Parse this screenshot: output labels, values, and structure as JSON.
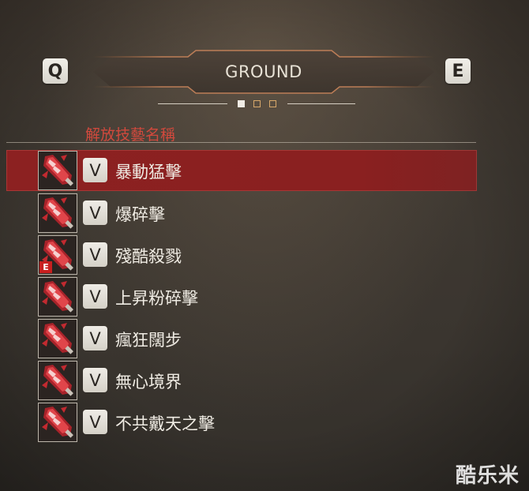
{
  "header": {
    "prev_key": "Q",
    "next_key": "E",
    "title": "GROUND",
    "pages": [
      {
        "state": "active"
      },
      {
        "state": "inactive"
      },
      {
        "state": "inactive"
      }
    ]
  },
  "list": {
    "column_label": "解放技藝名稱",
    "selected_index": 0,
    "rows": [
      {
        "key": "V",
        "name": "暴動猛擊",
        "badge": ""
      },
      {
        "key": "V",
        "name": "爆碎擊",
        "badge": ""
      },
      {
        "key": "V",
        "name": "殘酷殺戮",
        "badge": "E"
      },
      {
        "key": "V",
        "name": "上昇粉碎擊",
        "badge": ""
      },
      {
        "key": "V",
        "name": "瘋狂闊步",
        "badge": ""
      },
      {
        "key": "V",
        "name": "無心境界",
        "badge": ""
      },
      {
        "key": "V",
        "name": "不共戴天之擊",
        "badge": ""
      }
    ]
  },
  "icons": {
    "skill_icon": "crimson-blade-icon"
  },
  "colors": {
    "selected_row": "#8c2121",
    "column_label": "#d0493d",
    "badge": "#c81f1f"
  },
  "watermark": "酷乐米"
}
